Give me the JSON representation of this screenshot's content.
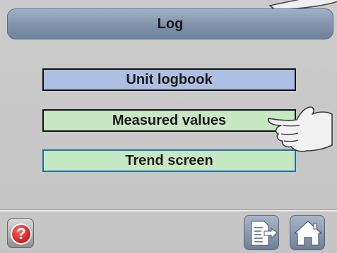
{
  "header": {
    "title": "Log"
  },
  "menu": {
    "items": [
      {
        "label": "Unit logbook"
      },
      {
        "label": "Measured values"
      },
      {
        "label": "Trend screen"
      }
    ]
  },
  "footer": {
    "help_symbol": "?"
  },
  "icons": {
    "help": "help-icon",
    "back": "back-arrow-page-icon",
    "home": "home-icon",
    "pointer": "pointing-hand-icon"
  },
  "colors": {
    "title_bar": "#7f92aa",
    "logbook_button": "#aebfe4",
    "measured_button": "#c8e7c3",
    "trend_button": "#c8e7c3",
    "trend_border": "#1d6fa6",
    "help_red": "#c41616"
  }
}
